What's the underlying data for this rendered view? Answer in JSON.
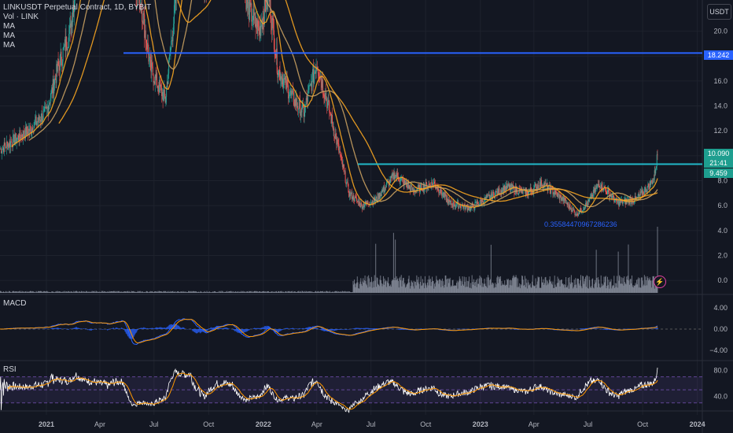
{
  "legend": {
    "title": "LINKUSDT Perpetual Contract, 1D, BYBIT",
    "vol": "Vol · LINK",
    "ma1": "MA",
    "ma2": "MA",
    "ma3": "MA"
  },
  "panes": {
    "macd": "MACD",
    "rsi": "RSI"
  },
  "currency_button": "USDT",
  "price_tags": {
    "level_high": "18.242",
    "last_price": "10.090",
    "countdown": "21:41",
    "ma_value": "9.459"
  },
  "annotation": "0.35584470967286236",
  "colors": {
    "up": "#26a69a",
    "down": "#ef5350",
    "ma_fast": "#f7a521",
    "ma_slow": "#c9a060",
    "hline_blue": "#2962ff",
    "hline_teal": "#22b8c8",
    "macd": "#2962ff",
    "signal": "#ff9800",
    "rsi": "#ffffff",
    "rsi_ma": "#ff9800",
    "grid": "#1e222d",
    "bg": "#131722"
  },
  "chart_data": [
    {
      "type": "candlestick",
      "title": "LINKUSDT Perpetual Contract, 1D, BYBIT",
      "x_ticks": [
        "2021",
        "Apr",
        "Jul",
        "Oct",
        "2022",
        "Apr",
        "Jul",
        "Oct",
        "2023",
        "Apr",
        "Jul",
        "Oct",
        "2024"
      ],
      "y_ticks": [
        0.0,
        2.0,
        4.0,
        6.0,
        8.0,
        10.0,
        12.0,
        14.0,
        16.0,
        18.0,
        20.0
      ],
      "ylim": [
        -1.0,
        22.5
      ],
      "grid": true,
      "horizontal_levels": [
        18.242,
        10.09
      ],
      "last_price": 10.09,
      "price_path": [
        [
          "2020-10-15",
          10.5
        ],
        [
          "2020-12-01",
          12.0
        ],
        [
          "2021-01-01",
          13.5
        ],
        [
          "2021-01-20",
          17.0
        ],
        [
          "2021-02-10",
          20.0
        ],
        [
          "2021-02-20",
          24.0
        ],
        [
          "2021-03-15",
          28.0
        ],
        [
          "2021-04-15",
          32.0
        ],
        [
          "2021-05-10",
          40.0
        ],
        [
          "2021-05-25",
          25.0
        ],
        [
          "2021-06-10",
          22.0
        ],
        [
          "2021-06-25",
          17.0
        ],
        [
          "2021-07-20",
          14.5
        ],
        [
          "2021-08-10",
          24.0
        ],
        [
          "2021-09-01",
          30.0
        ],
        [
          "2021-09-25",
          24.0
        ],
        [
          "2021-10-15",
          28.0
        ],
        [
          "2021-11-10",
          31.0
        ],
        [
          "2021-12-05",
          22.0
        ],
        [
          "2021-12-25",
          20.0
        ],
        [
          "2022-01-10",
          23.0
        ],
        [
          "2022-01-25",
          17.0
        ],
        [
          "2022-02-20",
          14.5
        ],
        [
          "2022-03-10",
          13.5
        ],
        [
          "2022-04-01",
          17.5
        ],
        [
          "2022-04-20",
          14.0
        ],
        [
          "2022-05-10",
          10.0
        ],
        [
          "2022-05-25",
          7.0
        ],
        [
          "2022-06-15",
          6.0
        ],
        [
          "2022-07-10",
          6.5
        ],
        [
          "2022-08-10",
          8.5
        ],
        [
          "2022-09-10",
          7.2
        ],
        [
          "2022-10-15",
          7.8
        ],
        [
          "2022-11-10",
          6.2
        ],
        [
          "2022-12-15",
          5.8
        ],
        [
          "2023-01-20",
          6.8
        ],
        [
          "2023-02-15",
          7.5
        ],
        [
          "2023-03-20",
          7.0
        ],
        [
          "2023-04-15",
          7.8
        ],
        [
          "2023-05-20",
          6.5
        ],
        [
          "2023-06-12",
          5.3
        ],
        [
          "2023-07-01",
          6.2
        ],
        [
          "2023-07-20",
          7.8
        ],
        [
          "2023-08-20",
          6.2
        ],
        [
          "2023-09-20",
          6.5
        ],
        [
          "2023-10-10",
          7.5
        ],
        [
          "2023-10-20",
          8.2
        ],
        [
          "2023-10-26",
          10.09
        ]
      ]
    },
    {
      "type": "bar",
      "name": "Vol · LINK",
      "ylim": [
        0,
        1
      ]
    },
    {
      "type": "line",
      "name": "MACD",
      "y_ticks": [
        -4.0,
        0.0,
        4.0
      ],
      "ylim": [
        -5.0,
        5.0
      ]
    },
    {
      "type": "line",
      "name": "RSI",
      "y_ticks": [
        40.0,
        80.0
      ],
      "bands": [
        30,
        70
      ],
      "ylim": [
        20,
        90
      ]
    }
  ]
}
